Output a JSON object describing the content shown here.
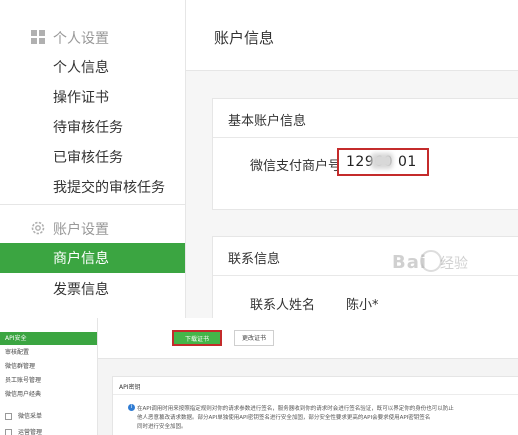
{
  "sidebar": {
    "personal_group": "个人设置",
    "personal_items": [
      "个人信息",
      "操作证书",
      "待审核任务",
      "已审核任务",
      "我提交的审核任务"
    ],
    "account_group": "账户设置",
    "account_items": [
      "商户信息",
      "发票信息"
    ],
    "active_item": "商户信息"
  },
  "main": {
    "title": "账户信息",
    "basic_card": {
      "header": "基本账户信息",
      "merchant_label": "微信支付商户号",
      "merchant_value": "12960  01"
    },
    "contact_card": {
      "header": "联系信息",
      "contact_label": "联系人姓名",
      "contact_value": "陈小*"
    }
  },
  "watermark": {
    "text": "Bai",
    "suffix": "经验"
  },
  "bottom": {
    "sidebar_items": [
      "API安全",
      "审核配置",
      "微信群管理",
      "员工账号管理",
      "微信用户经典"
    ],
    "sidebar_sub": [
      "微信采单",
      "运营管理"
    ],
    "buttons": {
      "download_cert": "下载证书",
      "change_cert": "更改证书"
    },
    "api_key_header": "API密钥",
    "notice_lines": [
      "在API调用时用来按照指定规则对你的请求参数进行签名，服务器收到你的请求时会进行签名验证，既可以界定你的身份也可以防止",
      "他人恶意篡改请求数据。部分API单独使用API密钥签名进行安全加固，部分安全性要求更高的API会要求使用API密钥签名",
      "同时进行安全加固。"
    ]
  },
  "colors": {
    "accent_green": "#3ba541",
    "highlight_red": "#c42b2b"
  }
}
